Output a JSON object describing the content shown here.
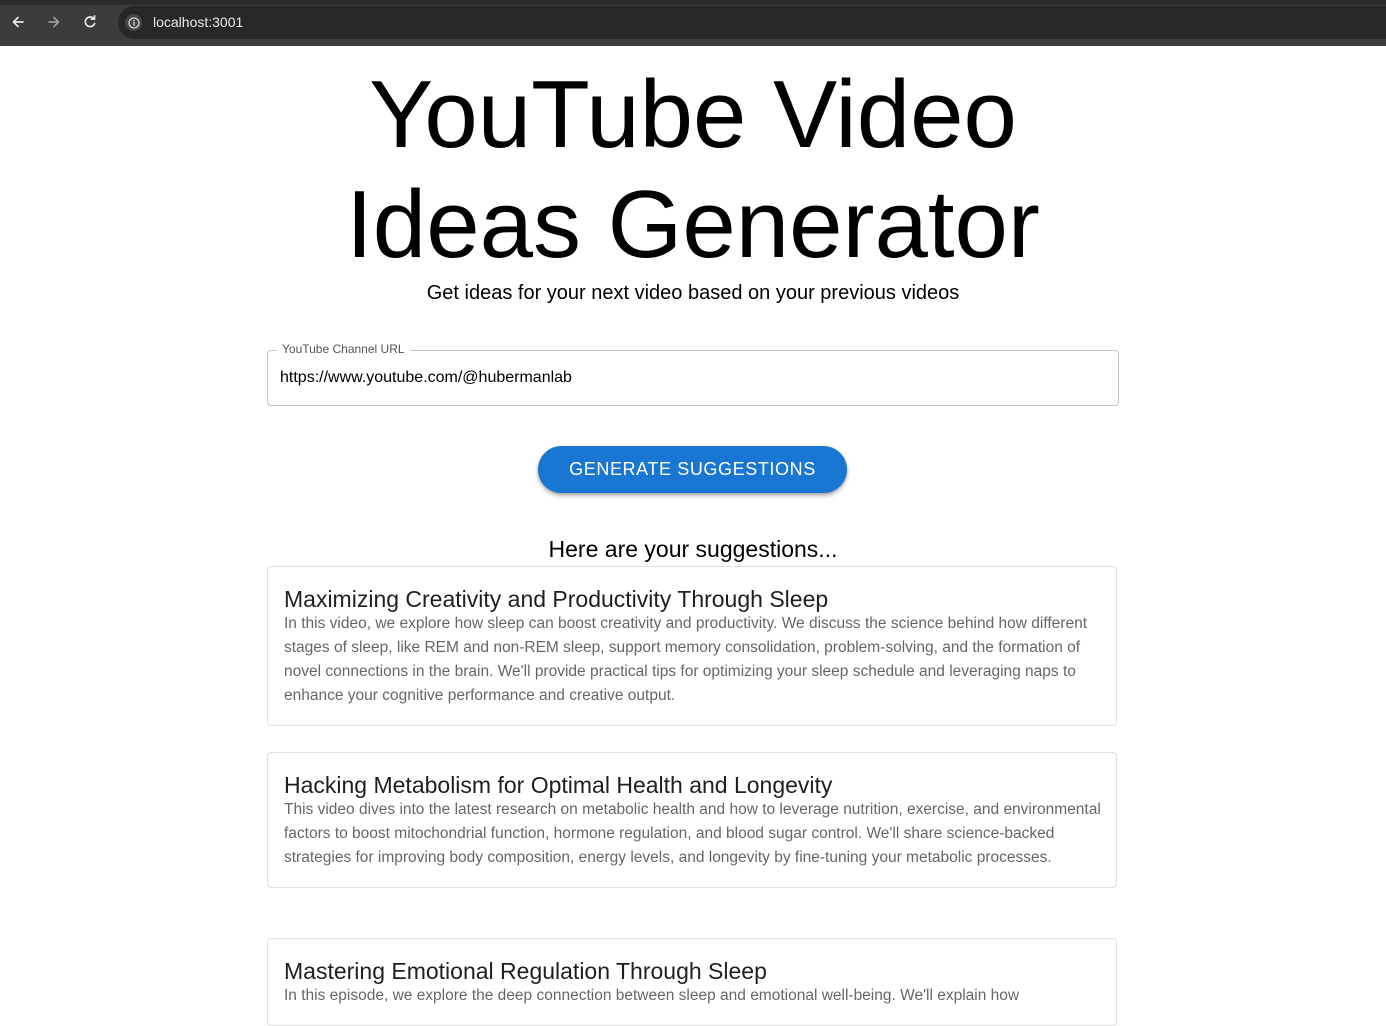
{
  "browser": {
    "url": "localhost:3001",
    "back_icon": "arrow-left-icon",
    "forward_icon": "arrow-right-icon",
    "reload_icon": "reload-icon",
    "info_icon": "info-icon"
  },
  "header": {
    "title_line1": "YouTube Video",
    "title_line2": "Ideas Generator",
    "subtitle": "Get ideas for your next video based on your previous videos"
  },
  "form": {
    "channel_label": "YouTube Channel URL",
    "channel_value": "https://www.youtube.com/@hubermanlab",
    "generate_label": "GENERATE SUGGESTIONS"
  },
  "colors": {
    "accent": "#1976d2"
  },
  "suggestions": {
    "heading": "Here are your suggestions...",
    "items": [
      {
        "title": "Maximizing Creativity and Productivity Through Sleep",
        "description": "In this video, we explore how sleep can boost creativity and productivity. We discuss the science behind how different stages of sleep, like REM and non-REM sleep, support memory consolidation, problem-solving, and the formation of novel connections in the brain. We'll provide practical tips for optimizing your sleep schedule and leveraging naps to enhance your cognitive performance and creative output."
      },
      {
        "title": "Hacking Metabolism for Optimal Health and Longevity",
        "description": "This video dives into the latest research on metabolic health and how to leverage nutrition, exercise, and environmental factors to boost mitochondrial function, hormone regulation, and blood sugar control. We'll share science-backed strategies for improving body composition, energy levels, and longevity by fine-tuning your metabolic processes."
      },
      {
        "title": "Mastering Emotional Regulation Through Sleep",
        "description": "In this episode, we explore the deep connection between sleep and emotional well-being. We'll explain how"
      }
    ]
  }
}
